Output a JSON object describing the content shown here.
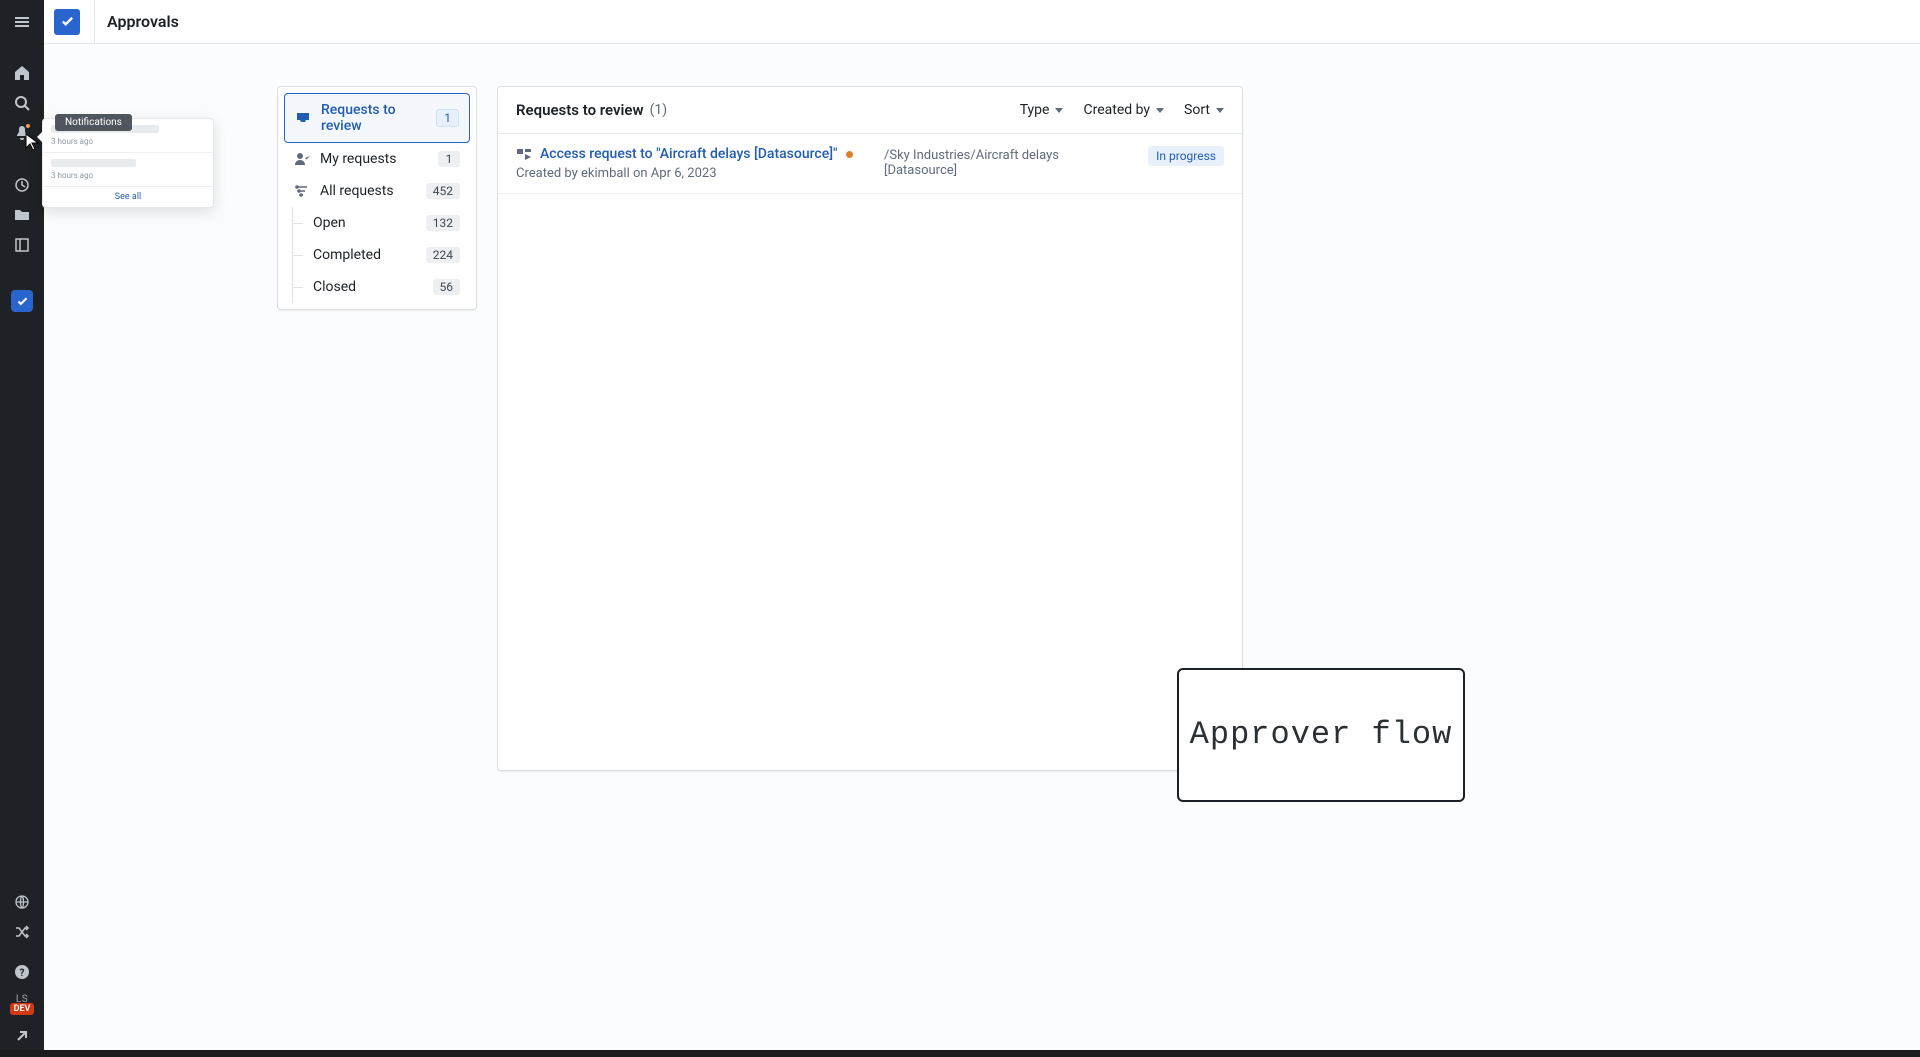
{
  "header": {
    "title": "Approvals"
  },
  "notifications": {
    "tooltip": "Notifications",
    "items": [
      {
        "time": "3 hours ago"
      },
      {
        "time": "3 hours ago"
      }
    ],
    "see_all": "See all"
  },
  "nav": {
    "ls_label": "LS",
    "dev_label": "DEV"
  },
  "sidebar": {
    "items": [
      {
        "label": "Requests to review",
        "count": "1",
        "active": true
      },
      {
        "label": "My requests",
        "count": "1"
      },
      {
        "label": "All requests",
        "count": "452"
      }
    ],
    "sub_items": [
      {
        "label": "Open",
        "count": "132"
      },
      {
        "label": "Completed",
        "count": "224"
      },
      {
        "label": "Closed",
        "count": "56"
      }
    ]
  },
  "panel": {
    "title": "Requests to review",
    "count": "(1)",
    "filters": {
      "type": "Type",
      "created_by": "Created by",
      "sort": "Sort"
    }
  },
  "requests": [
    {
      "title": "Access request to \"Aircraft delays [Datasource]\"",
      "subtitle": "Created by ekimball on Apr 6, 2023",
      "path": "/Sky Industries/Aircraft delays [Datasource]",
      "status": "In progress"
    }
  ],
  "annotation": {
    "text": "Approver flow"
  }
}
